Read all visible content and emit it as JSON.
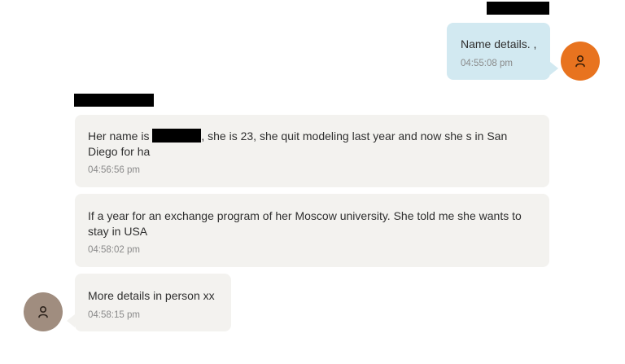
{
  "colors": {
    "incoming_bubble": "#f3f2ef",
    "outgoing_bubble": "#d2e9f1",
    "self_avatar": "#e8731f",
    "contact_avatar": "#a08d7f",
    "redaction": "#000000"
  },
  "self": {
    "avatar_icon": "user-icon"
  },
  "contact": {
    "avatar_icon": "user-icon"
  },
  "messages": [
    {
      "direction": "outgoing",
      "text": "Name details. ,",
      "time": "04:55:08 pm"
    },
    {
      "direction": "incoming",
      "text_before_redaction": "Her name is ",
      "text_after_redaction": ", she is 23, she quit modeling last year and now she s in San Diego for ha",
      "time": "04:56:56 pm"
    },
    {
      "direction": "incoming",
      "text": "If a year for an exchange program of her Moscow university. She told me she wants to stay in USA",
      "time": "04:58:02 pm"
    },
    {
      "direction": "incoming",
      "text": "More details in person xx",
      "time": "04:58:15 pm"
    }
  ]
}
